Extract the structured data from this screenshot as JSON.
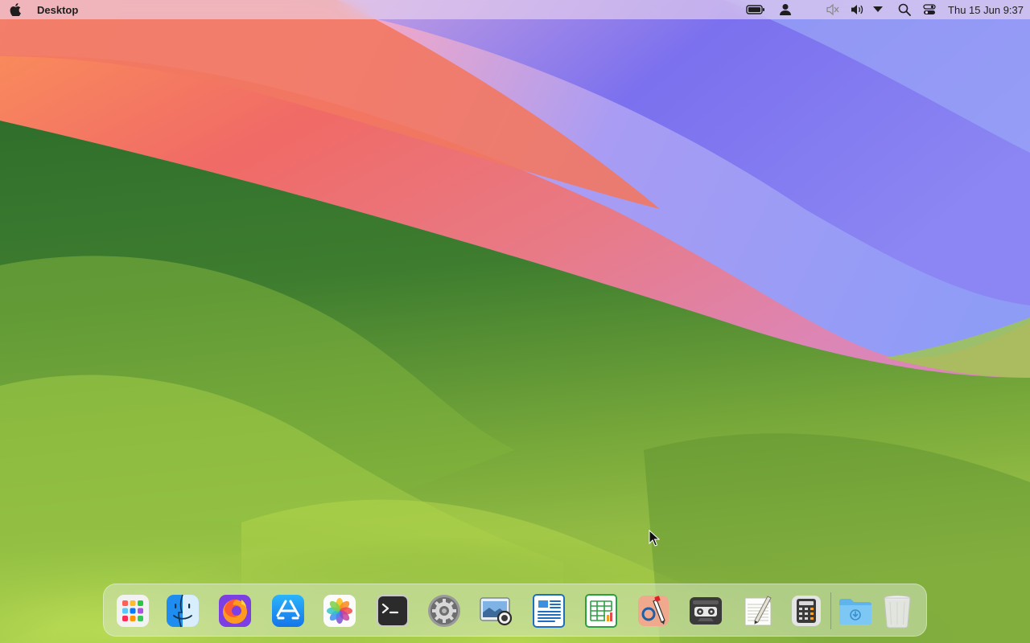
{
  "menubar": {
    "active_app": "Desktop",
    "clock": "Thu 15 Jun 9:37",
    "status_icons": [
      "apple-logo-icon",
      "battery-icon",
      "user-icon",
      "mute-icon",
      "volume-icon",
      "dropdown-icon",
      "search-icon",
      "control-center-icon"
    ]
  },
  "dock": {
    "apps": [
      {
        "name": "Launchpad",
        "icon": "launchpad-icon"
      },
      {
        "name": "Finder",
        "icon": "finder-icon"
      },
      {
        "name": "Firefox",
        "icon": "firefox-icon"
      },
      {
        "name": "App Store",
        "icon": "app-store-icon"
      },
      {
        "name": "Photos",
        "icon": "photos-icon"
      },
      {
        "name": "Terminal",
        "icon": "terminal-icon"
      },
      {
        "name": "System Preferences",
        "icon": "system-preferences-icon"
      },
      {
        "name": "Screenshot",
        "icon": "screenshot-icon"
      },
      {
        "name": "Writer",
        "icon": "document-writer-icon"
      },
      {
        "name": "Spreadsheet",
        "icon": "spreadsheet-icon"
      },
      {
        "name": "Drawing",
        "icon": "drawing-icon"
      },
      {
        "name": "Cassette Player",
        "icon": "cassette-icon"
      },
      {
        "name": "Text Editor",
        "icon": "text-editor-icon"
      },
      {
        "name": "Calculator",
        "icon": "calculator-icon"
      },
      {
        "name": "Downloads",
        "icon": "downloads-folder-icon"
      },
      {
        "name": "Trash",
        "icon": "trash-icon"
      }
    ]
  },
  "colors": {
    "menubar_bg": "#eed6ee",
    "wallpaper_green": "#4f8a2a",
    "wallpaper_red": "#ee6a64",
    "wallpaper_blue": "#7a7cf2"
  }
}
